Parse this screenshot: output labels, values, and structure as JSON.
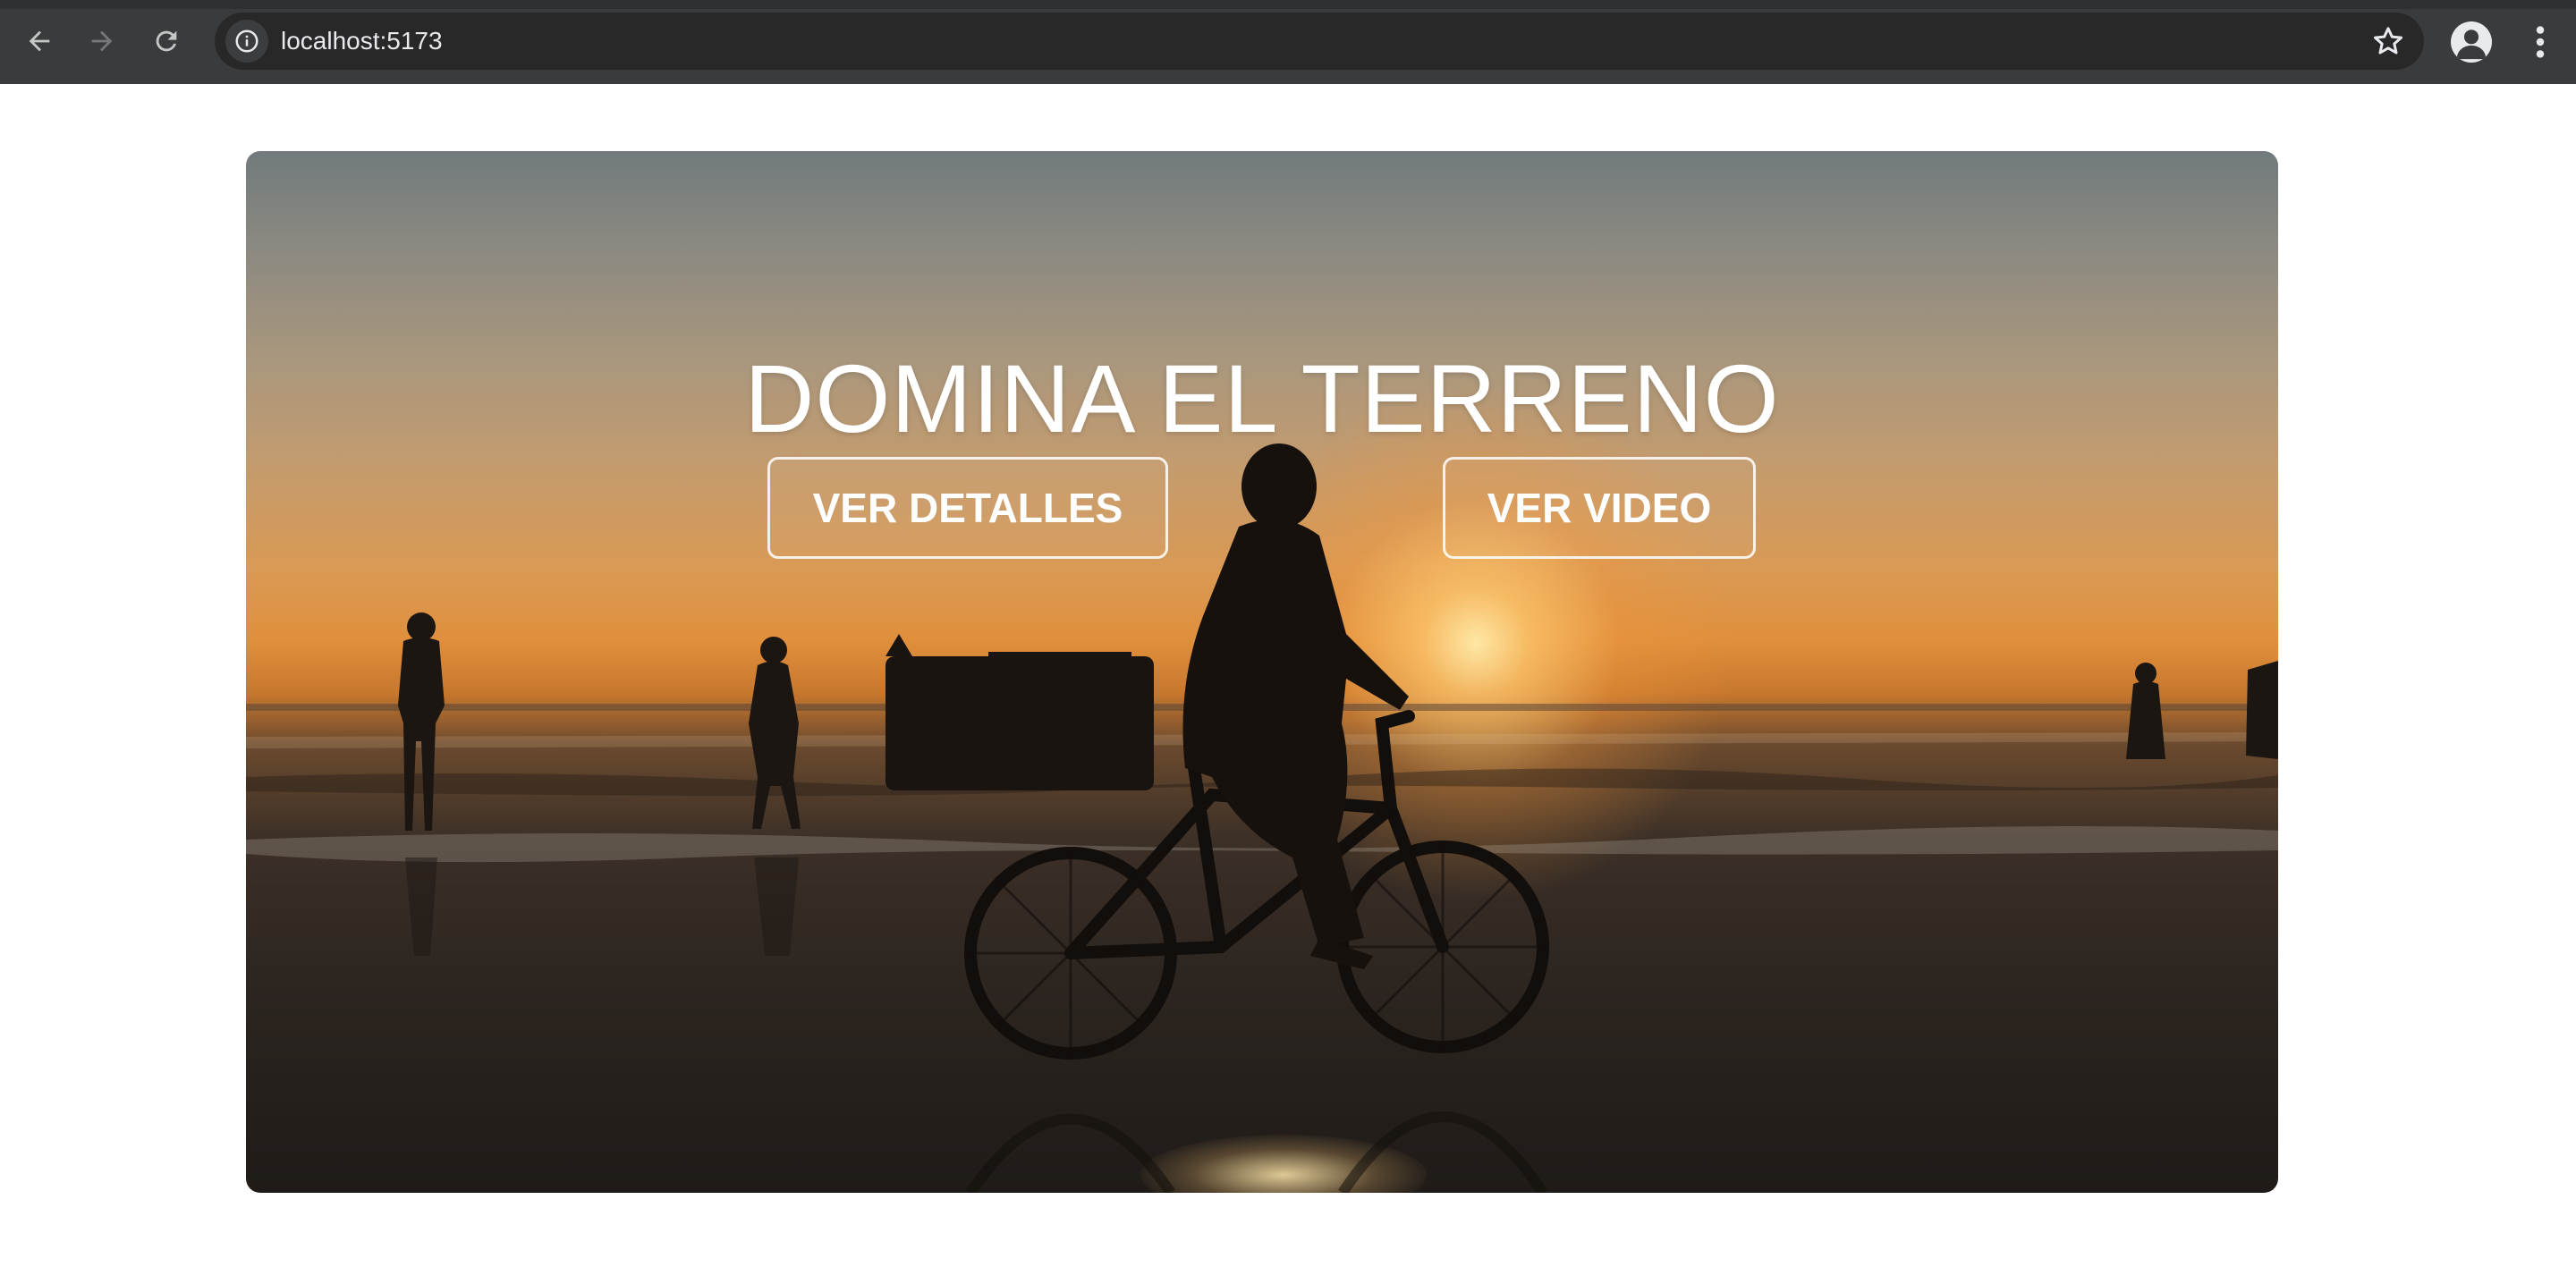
{
  "browser": {
    "url": "localhost:5173",
    "icons": [
      "back-arrow-icon",
      "forward-arrow-icon",
      "reload-icon",
      "info-icon",
      "star-icon",
      "profile-icon",
      "kebab-menu-icon"
    ]
  },
  "hero": {
    "title": "DOMINA EL TERRENO",
    "buttons": {
      "details_label": "VER DETALLES",
      "video_label": "VER VIDEO"
    }
  },
  "colors": {
    "chrome_bar": "#3a3b3d",
    "omnibox": "#282828",
    "hero_text": "#ffffff",
    "sunset_orange": "#e08f3c"
  }
}
